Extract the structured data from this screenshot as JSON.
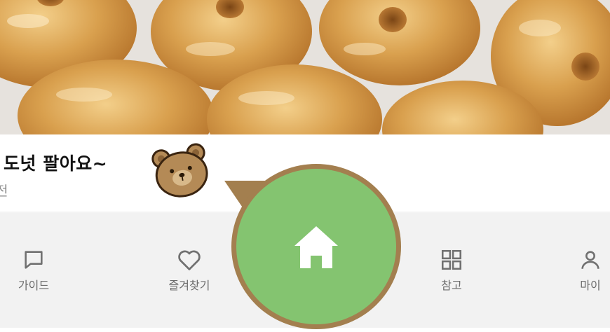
{
  "post": {
    "title": "도넛 팔아요~",
    "time": "전"
  },
  "nav": {
    "items": [
      {
        "label": "가이드",
        "icon": "chat-icon"
      },
      {
        "label": "즐겨찾기",
        "icon": "heart-icon"
      },
      {
        "label": "",
        "icon": "home-icon"
      },
      {
        "label": "참고",
        "icon": "grid-icon"
      },
      {
        "label": "마이",
        "icon": "person-icon"
      }
    ]
  },
  "colors": {
    "home_fill": "#84c470",
    "home_ring": "#a37f4f",
    "bear": "#b48a56"
  }
}
